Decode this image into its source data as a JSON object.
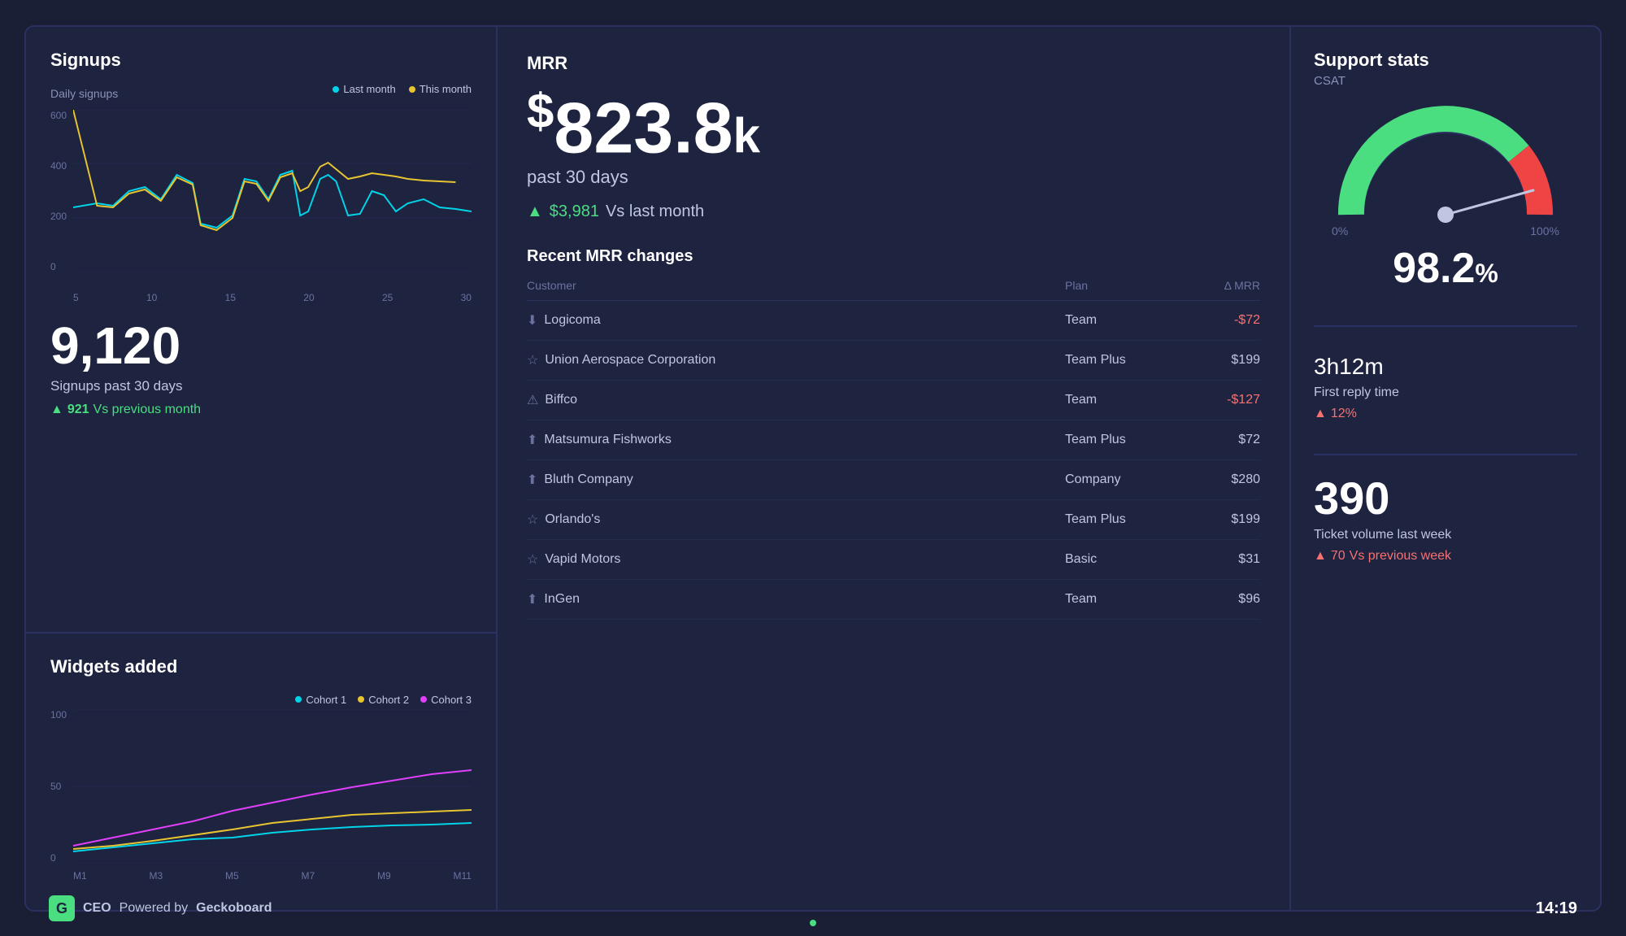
{
  "dashboard": {
    "background_color": "#1e2340"
  },
  "signups": {
    "title": "Signups",
    "chart_label": "Daily signups",
    "legend": {
      "last_month": "Last month",
      "this_month": "This month",
      "last_month_color": "#00d4e8",
      "this_month_color": "#e8c530"
    },
    "y_axis": [
      "600",
      "400",
      "200",
      "0"
    ],
    "x_axis": [
      "5",
      "10",
      "15",
      "20",
      "25",
      "30"
    ],
    "big_number": "9,120",
    "sub_label": "Signups past 30 days",
    "change_value": "921",
    "change_label": "Vs previous month"
  },
  "widgets": {
    "title": "Widgets added",
    "legend": {
      "cohort1": "Cohort 1",
      "cohort2": "Cohort 2",
      "cohort3": "Cohort 3",
      "c1_color": "#00d4e8",
      "c2_color": "#e8c530",
      "c3_color": "#e040fb"
    },
    "y_axis": [
      "100",
      "50",
      "0"
    ],
    "x_axis": [
      "M1",
      "M3",
      "M5",
      "M7",
      "M9",
      "M11"
    ]
  },
  "mrr": {
    "title": "MRR",
    "amount": "823.8",
    "period": "past 30 days",
    "change_value": "$3,981",
    "change_label": "Vs last month",
    "changes_title": "Recent MRR changes",
    "table_headers": {
      "customer": "Customer",
      "plan": "Plan",
      "mrr": "Δ MRR"
    },
    "rows": [
      {
        "icon": "down",
        "customer": "Logicoma",
        "plan": "Team",
        "mrr": "-$72",
        "negative": true
      },
      {
        "icon": "star",
        "customer": "Union Aerospace Corporation",
        "plan": "Team Plus",
        "mrr": "$199",
        "negative": false
      },
      {
        "icon": "triangle",
        "customer": "Biffco",
        "plan": "Team",
        "mrr": "-$127",
        "negative": true
      },
      {
        "icon": "up",
        "customer": "Matsumura Fishworks",
        "plan": "Team Plus",
        "mrr": "$72",
        "negative": false
      },
      {
        "icon": "up",
        "customer": "Bluth Company",
        "plan": "Company",
        "mrr": "$280",
        "negative": false
      },
      {
        "icon": "star",
        "customer": "Orlando's",
        "plan": "Team Plus",
        "mrr": "$199",
        "negative": false
      },
      {
        "icon": "star",
        "customer": "Vapid Motors",
        "plan": "Basic",
        "mrr": "$31",
        "negative": false
      },
      {
        "icon": "up",
        "customer": "InGen",
        "plan": "Team",
        "mrr": "$96",
        "negative": false
      }
    ]
  },
  "support": {
    "title": "Support stats",
    "csat_label": "CSAT",
    "gauge_value": "98.2",
    "gauge_unit": "%",
    "gauge_min": "0%",
    "gauge_max": "100%",
    "reply_time_h": "3",
    "reply_time_h_label": "h",
    "reply_time_m": "12",
    "reply_time_m_label": "m",
    "reply_label": "First reply time",
    "reply_change": "12%",
    "ticket_volume": "390",
    "ticket_label": "Ticket volume last week",
    "ticket_change": "70",
    "ticket_change_label": "Vs previous week"
  },
  "footer": {
    "brand_name": "CEO",
    "powered_by": "Powered by",
    "company": "Geckoboard",
    "time": "14:19"
  }
}
